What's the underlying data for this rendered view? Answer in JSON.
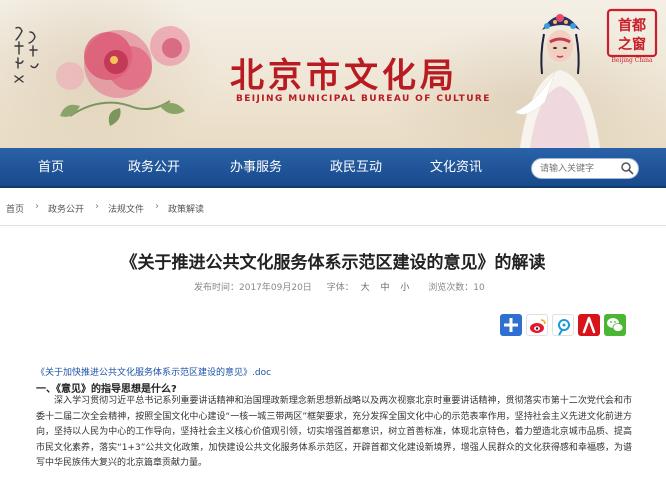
{
  "header": {
    "title": "北京市文化局",
    "subtitle": "BEIJING MUNICIPAL BUREAU OF CULTURE",
    "seal_text": "首都之窗",
    "seal_subtext": "Beijing China"
  },
  "nav": {
    "items": [
      "首页",
      "政务公开",
      "办事服务",
      "政民互动",
      "文化资讯"
    ],
    "search_placeholder": "请输入关键字"
  },
  "breadcrumb": [
    "首页",
    "政务公开",
    "法规文件",
    "政策解读"
  ],
  "article": {
    "title": "《关于推进公共文化服务体系示范区建设的意见》的解读",
    "publish_label": "发布时间：2017年09月20日",
    "font_label": "字体：",
    "font_sizes": [
      "大",
      "中",
      "小"
    ],
    "views_label": "浏览次数：10",
    "attachment": "《关于加快推进公共文化服务体系示范区建设的意见》.doc",
    "section1_heading": "一、《意见》的指导思想是什么?",
    "section1_body": "深入学习贯彻习近平总书记系列重要讲话精神和治国理政新理念新思想新战略以及两次视察北京时重要讲话精神，贯彻落实市第十二次党代会和市委十二届二次全会精神，按照全国文化中心建设“一核一城三带两区”框架要求，充分发挥全国文化中心的示范表率作用，坚持社会主义先进文化前进方向，坚持以人民为中心的工作导向，坚持社会主义核心价值观引领，切实增强首都意识，树立首善标准，体现北京特色，着力塑造北京城市品质、提高市民文化素养，落实“1+3”公共文化政策，加快建设公共文化服务体系示范区，开辟首都文化建设新境界，增强人民群众的文化获得感和幸福感，为谱写中华民族伟大复兴的北京篇章贡献力量。"
  },
  "share_icons": [
    "plus-share-icon",
    "weibo-icon",
    "tencent-weibo-icon",
    "renren-icon",
    "wechat-icon"
  ],
  "colors": {
    "brand_red": "#b81c22",
    "nav_blue": "#1f5299",
    "link_blue": "#1d52a8"
  }
}
